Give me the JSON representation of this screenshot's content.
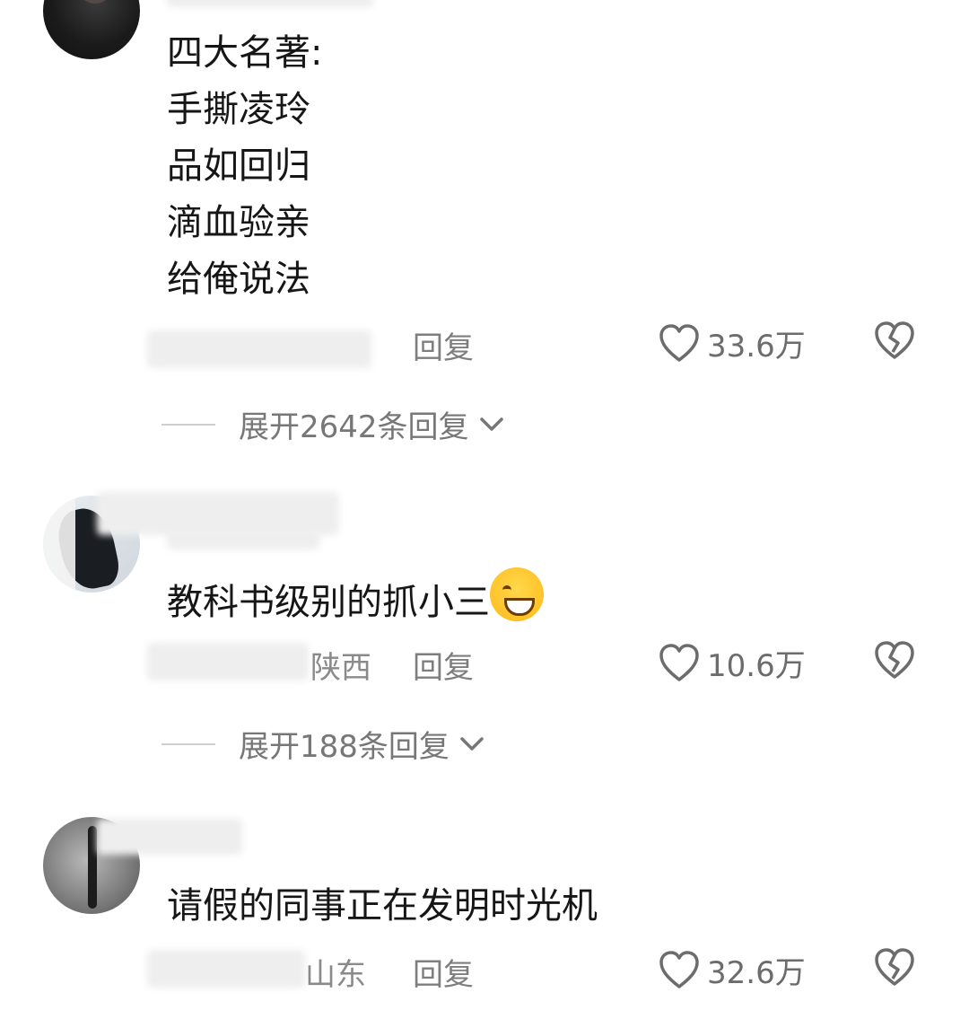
{
  "comments": [
    {
      "lines": [
        "四大名著:",
        "手撕凌玲",
        "品如回归",
        "滴血验亲",
        "给俺说法"
      ],
      "location": "",
      "reply_label": "回复",
      "likes": "33.6万",
      "expand_label": "展开2642条回复"
    },
    {
      "text": "教科书级别的抓小三",
      "location": "陕西",
      "reply_label": "回复",
      "likes": "10.6万",
      "expand_label": "展开188条回复"
    },
    {
      "text": "请假的同事正在发明时光机",
      "location": "山东",
      "reply_label": "回复",
      "likes": "32.6万"
    }
  ],
  "icons": {
    "like": "heart-outline-icon",
    "dislike": "broken-heart-icon",
    "expand": "chevron-down-icon",
    "emoji": "grinning-face-emoji"
  }
}
